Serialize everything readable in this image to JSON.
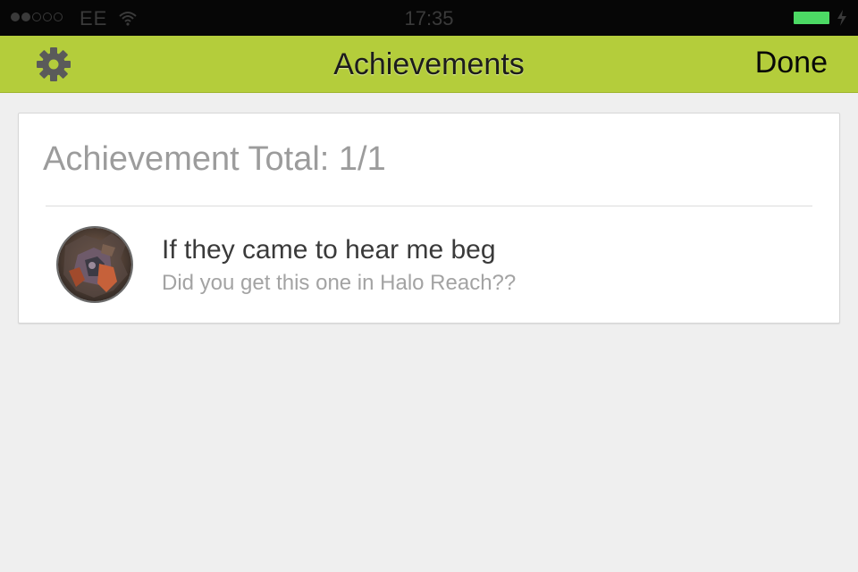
{
  "status_bar": {
    "carrier": "EE",
    "time": "17:35",
    "signal_bars_filled": 2,
    "signal_bars_total": 5,
    "battery_color": "#4cd964"
  },
  "nav": {
    "title": "Achievements",
    "done_label": "Done",
    "settings_icon": "gear-icon",
    "bar_color": "#b4cd3b"
  },
  "summary": {
    "total_label": "Achievement Total: 1/1"
  },
  "achievements": [
    {
      "title": "If they came to hear me beg",
      "description": "Did you get this one in Halo Reach??",
      "icon": "achievement-image"
    }
  ]
}
